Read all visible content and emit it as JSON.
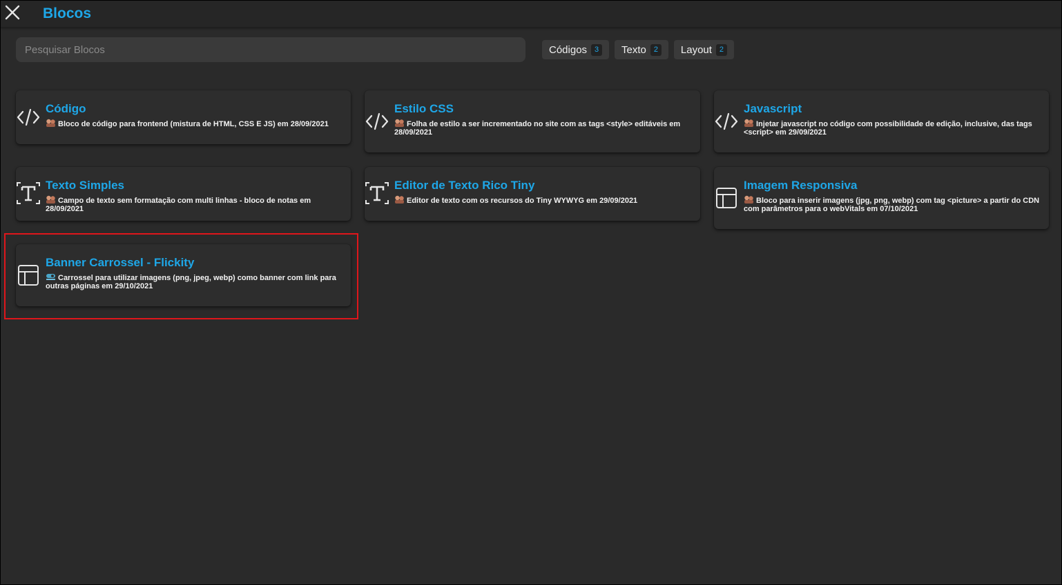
{
  "header": {
    "title": "Blocos"
  },
  "search": {
    "placeholder": "Pesquisar Blocos",
    "value": ""
  },
  "filters": [
    {
      "label": "Códigos",
      "count": "3"
    },
    {
      "label": "Texto",
      "count": "2"
    },
    {
      "label": "Layout",
      "count": "2"
    }
  ],
  "blocks": [
    {
      "title": "Código",
      "icon": "code-icon",
      "description": "Bloco de código para frontend (mistura de HTML, CSS E JS) em 28/09/2021"
    },
    {
      "title": "Estilo CSS",
      "icon": "code-icon",
      "description": "Folha de estilo a ser incrementado no site com as tags <style> editáveis em 28/09/2021"
    },
    {
      "title": "Javascript",
      "icon": "code-icon",
      "description": "Injetar javascript no código com possibilidade de edição, inclusive, das tags <script> em 29/09/2021"
    },
    {
      "title": "Texto Simples",
      "icon": "text-format-icon",
      "description": "Campo de texto sem formatação com multi linhas - bloco de notas em 28/09/2021"
    },
    {
      "title": "Editor de Texto Rico Tiny",
      "icon": "text-format-icon",
      "description": "Editor de texto com os recursos do Tiny WYWYG em 29/09/2021"
    },
    {
      "title": "Imagem Responsiva",
      "icon": "layout-icon",
      "description": "Bloco para inserir imagens (jpg, png, webp) com tag <picture> a partir do CDN com parâmetros para o webVitals em 07/10/2021"
    },
    {
      "title": "Banner Carrossel - Flickity",
      "icon": "layout-icon",
      "description": "Carrossel para utilizar imagens (png, jpeg, webp) como banner com link para outras páginas em 29/10/2021"
    }
  ],
  "colors": {
    "accent": "#1ea7e8",
    "background": "#2a2a2a",
    "card": "#2d2d2d",
    "highlight": "#e0161b"
  }
}
